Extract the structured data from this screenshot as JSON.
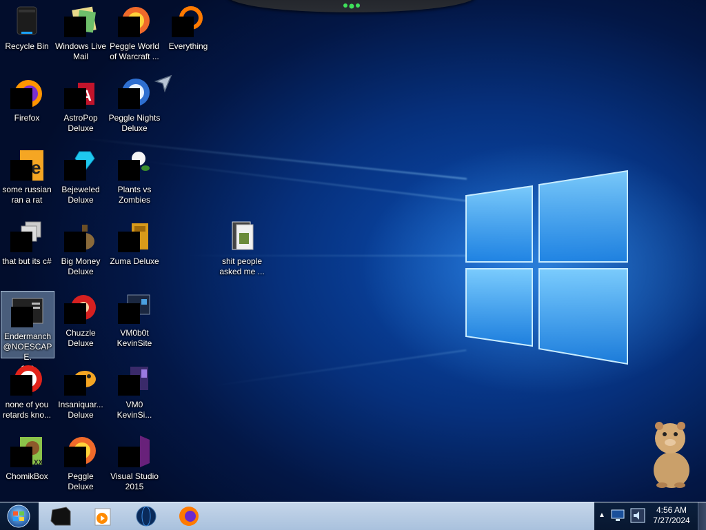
{
  "desktop": {
    "icons": [
      {
        "label": "Recycle Bin",
        "icon": "recycle-bin-icon"
      },
      {
        "label": "Windows Live\nMail",
        "icon": "mail-icon"
      },
      {
        "label": "Peggle World\nof Warcraft ...",
        "icon": "peggle-icon"
      },
      {
        "label": "Everything",
        "icon": "search-magnifier-icon"
      },
      {
        "label": "Firefox",
        "icon": "firefox-icon"
      },
      {
        "label": "AstroPop\nDeluxe",
        "icon": "astropop-icon"
      },
      {
        "label": "Peggle Nights\nDeluxe",
        "icon": "peggle-nights-icon"
      },
      {
        "label": "some russian\nran a rat",
        "icon": "exe-file-icon"
      },
      {
        "label": "Bejeweled\nDeluxe",
        "icon": "gem-icon"
      },
      {
        "label": "Plants vs\nZombies",
        "icon": "plant-icon"
      },
      {
        "label": "that but its c#",
        "icon": "window-stack-icon"
      },
      {
        "label": "Big Money\nDeluxe",
        "icon": "money-bag-icon"
      },
      {
        "label": "Zuma Deluxe",
        "icon": "zuma-icon"
      },
      {
        "label": "shit people\nasked me ...",
        "icon": "folder-icon"
      },
      {
        "label": "Endermanch\n@NOESCAPE.\nexe",
        "icon": "console-app-icon"
      },
      {
        "label": "Chuzzle\nDeluxe",
        "icon": "chuzzle-icon"
      },
      {
        "label": "VM0b0t\nKevinSite",
        "icon": "vm-monitor-icon"
      },
      {
        "label": "none of you\nretards kno...",
        "icon": "red-circle-app-icon"
      },
      {
        "label": "Insaniquar...\nDeluxe",
        "icon": "fish-icon"
      },
      {
        "label": "VM0\nKevinSi...",
        "icon": "vm-app-icon"
      },
      {
        "label": "ChomikBox",
        "icon": "hamster-box-icon"
      },
      {
        "label": "Peggle Deluxe",
        "icon": "peggle-deluxe-icon"
      },
      {
        "label": "Visual Studio\n2015",
        "icon": "visual-studio-icon"
      }
    ]
  },
  "taskbar": {
    "pinned": [
      {
        "icon": "terminal-black-icon"
      },
      {
        "icon": "media-player-icon"
      },
      {
        "icon": "globe-icon"
      },
      {
        "icon": "firefox-icon"
      }
    ],
    "clock": {
      "time": "4:56 AM",
      "date": "7/27/2024"
    }
  },
  "colors": {
    "accent": "#1e6fd8",
    "taskbar": "#b6cbe3",
    "tray": "#0b1f3d"
  }
}
